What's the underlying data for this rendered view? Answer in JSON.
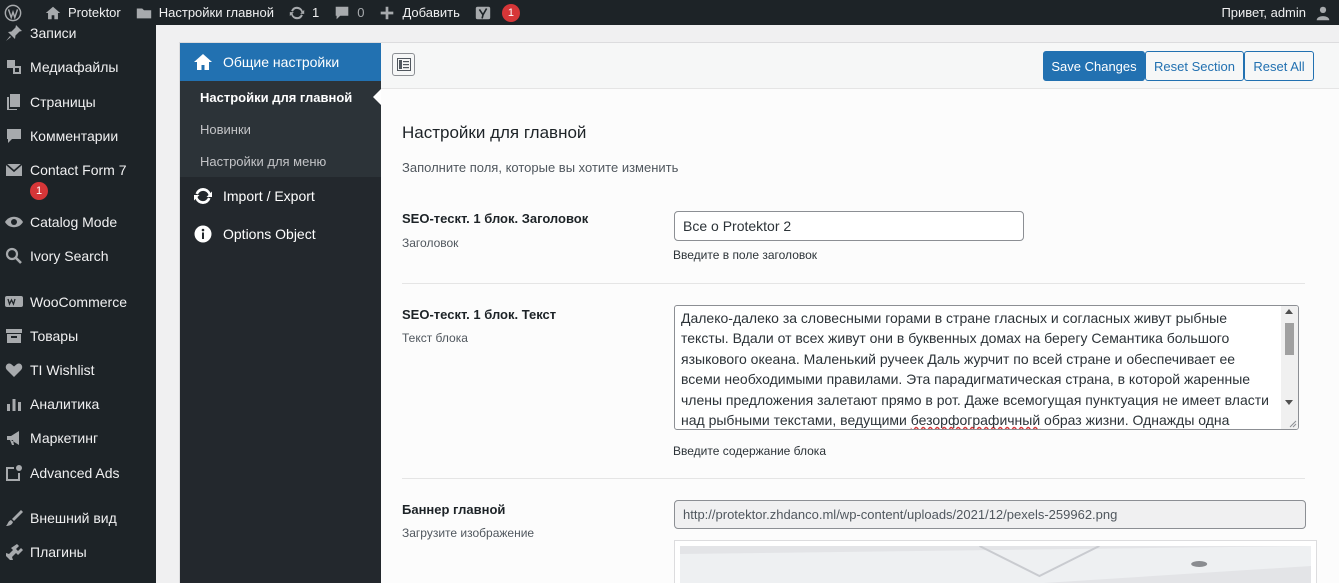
{
  "adminbar": {
    "site_name": "Protektor",
    "page_link": "Настройки главной",
    "updates_count": "1",
    "comments_count": "0",
    "add_new": "Добавить",
    "yoast_count": "1",
    "greeting": "Привет, admin"
  },
  "menu": {
    "items": [
      {
        "label": "Записи",
        "icon": "pin-icon"
      },
      {
        "label": "Медиафайлы",
        "icon": "media-icon"
      },
      {
        "label": "Страницы",
        "icon": "pages-icon"
      },
      {
        "label": "Комментарии",
        "icon": "comments-icon"
      },
      {
        "label": "Contact Form 7",
        "icon": "mail-icon",
        "count": "1"
      },
      {
        "label": "Catalog Mode",
        "icon": "eye-icon"
      },
      {
        "label": "Ivory Search",
        "icon": "search-icon"
      },
      {
        "label": "WooCommerce",
        "icon": "woo-icon"
      },
      {
        "label": "Товары",
        "icon": "archive-icon"
      },
      {
        "label": "TI Wishlist",
        "icon": "heart-icon"
      },
      {
        "label": "Аналитика",
        "icon": "chart-icon"
      },
      {
        "label": "Маркетинг",
        "icon": "megaphone-icon"
      },
      {
        "label": "Advanced Ads",
        "icon": "ads-icon"
      },
      {
        "label": "Внешний вид",
        "icon": "brush-icon"
      },
      {
        "label": "Плагины",
        "icon": "plugin-icon"
      }
    ]
  },
  "redux": {
    "groups": [
      {
        "label": "Общие настройки",
        "icon": "home-icon"
      },
      {
        "label": "Import / Export",
        "icon": "refresh-icon"
      },
      {
        "label": "Options Object",
        "icon": "info-icon"
      }
    ],
    "subsections": [
      {
        "label": "Настройки для главной"
      },
      {
        "label": "Новинки"
      },
      {
        "label": "Настройки для меню"
      }
    ],
    "buttons": {
      "save": "Save Changes",
      "reset_section": "Reset Section",
      "reset_all": "Reset All"
    },
    "section_title": "Настройки для главной",
    "section_desc": "Заполните поля, которые вы хотите изменить",
    "fields": {
      "heading": {
        "title": "SEO-тескт. 1 блок. Заголовок",
        "subtitle": "Заголовок",
        "value": "Все о Protektor 2",
        "hint": "Введите в поле заголовок"
      },
      "text": {
        "title": "SEO-тескт. 1 блок. Текст",
        "subtitle": "Текст блока",
        "value_before": "Далеко-далеко за словесными горами в стране гласных и согласных живут рыбные тексты. Вдали от всех живут они в буквенных домах на берегу Семантика большого языкового океана. Маленький ручеек Даль журчит по всей стране и обеспечивает ее всеми необходимыми правилами. Эта парадигматическая страна, в которой жаренные члены предложения залетают прямо в рот. Даже всемогущая пунктуация не имеет власти над рыбными текстами, ведущими ",
        "misspelled": "безорфографичный",
        "value_after": " образ жизни. Однажды одна маленькая",
        "hint": "Введите содержание блока"
      },
      "banner": {
        "title": "Баннер главной",
        "subtitle": "Загрузите изображение",
        "url": "http://protektor.zhdanco.ml/wp-content/uploads/2021/12/pexels-259962.png"
      }
    }
  },
  "colors": {
    "accent": "#2271b1",
    "badge": "#d63638",
    "menu_bg": "#1d2327"
  }
}
